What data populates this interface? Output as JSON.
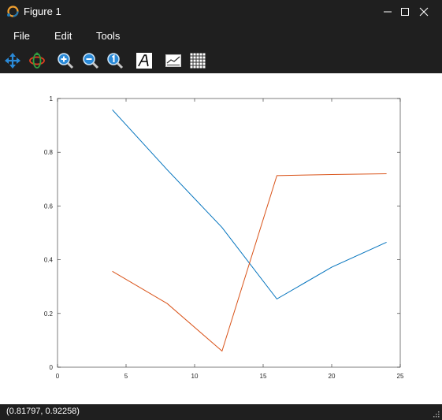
{
  "window": {
    "title": "Figure 1"
  },
  "menu": {
    "file": "File",
    "edit": "Edit",
    "tools": "Tools"
  },
  "toolbar": {
    "tools": [
      "pan-icon",
      "rotate-icon",
      "zoom-in-icon",
      "zoom-out-icon",
      "zoom-reset-icon",
      "text-icon",
      "axes-box-icon",
      "grid-icon"
    ]
  },
  "status": {
    "coordinates": "(0.81797, 0.92258)"
  },
  "colors": {
    "series1": "#0072bd",
    "series2": "#d95319",
    "chrome": "#1f1f1f"
  },
  "chart_data": {
    "type": "line",
    "xlim": [
      0,
      25
    ],
    "ylim": [
      0,
      1
    ],
    "xticks": [
      0,
      5,
      10,
      15,
      20,
      25
    ],
    "yticks": [
      0,
      0.2,
      0.4,
      0.6,
      0.8,
      1
    ],
    "xtick_labels": [
      "0",
      "5",
      "10",
      "15",
      "20",
      "25"
    ],
    "ytick_labels": [
      "0",
      "0.2",
      "0.4",
      "0.6",
      "0.8",
      "1"
    ],
    "grid": false,
    "series": [
      {
        "color": "#0072bd",
        "x": [
          4,
          8,
          12,
          16,
          20,
          24
        ],
        "y": [
          0.958,
          0.735,
          0.52,
          0.254,
          0.372,
          0.465
        ]
      },
      {
        "color": "#d95319",
        "x": [
          4,
          8,
          12,
          16,
          20,
          24
        ],
        "y": [
          0.357,
          0.237,
          0.06,
          0.713,
          0.717,
          0.72
        ]
      }
    ]
  }
}
